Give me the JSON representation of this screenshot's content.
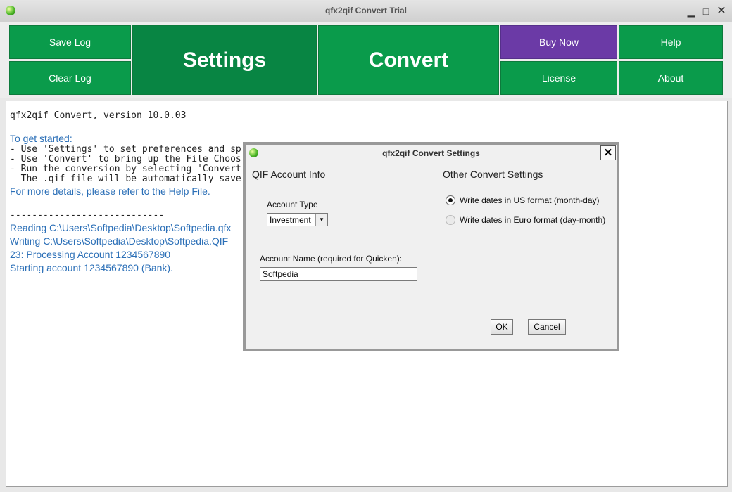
{
  "window": {
    "title": "qfx2qif Convert Trial",
    "minimize": "▁",
    "maximize": "□",
    "close": "✕",
    "icon": "app-logo-icon"
  },
  "toolbar": {
    "save_log": "Save Log",
    "clear_log": "Clear Log",
    "settings": "Settings",
    "convert": "Convert",
    "buy_now": "Buy Now",
    "license": "License",
    "help": "Help",
    "about": "About",
    "colors": {
      "green": "#0a9b4b",
      "dark_green": "#088543",
      "purple": "#6b3aa6"
    }
  },
  "log": {
    "version": "qfx2qif Convert, version 10.0.03",
    "get_started": "To get started:",
    "step1": "- Use 'Settings' to set preferences and sp",
    "step2": "- Use 'Convert' to bring up the File Choos",
    "step3": "- Run the conversion by selecting 'Convert",
    "step4": "  The .qif file will be automatically save",
    "details": "For more details, please refer to the Help File.",
    "separator": "----------------------------",
    "reading": "Reading C:\\Users\\Softpedia\\Desktop\\Softpedia.qfx",
    "writing": "Writing C:\\Users\\Softpedia\\Desktop\\Softpedia.QIF",
    "processing": "23: Processing Account 1234567890",
    "starting": "Starting account 1234567890 (Bank)."
  },
  "dialog": {
    "title": "qfx2qif Convert Settings",
    "close": "✕",
    "qif_section": "QIF Account Info",
    "account_type_label": "Account Type",
    "account_type_value": "Investment",
    "account_name_label": "Account Name (required for Quicken):",
    "account_name_value": "Softpedia",
    "other_section": "Other Convert Settings",
    "date_us": "Write dates in US format (month-day)",
    "date_euro": "Write dates in Euro format (day-month)",
    "date_us_selected": true,
    "ok": "OK",
    "cancel": "Cancel"
  }
}
